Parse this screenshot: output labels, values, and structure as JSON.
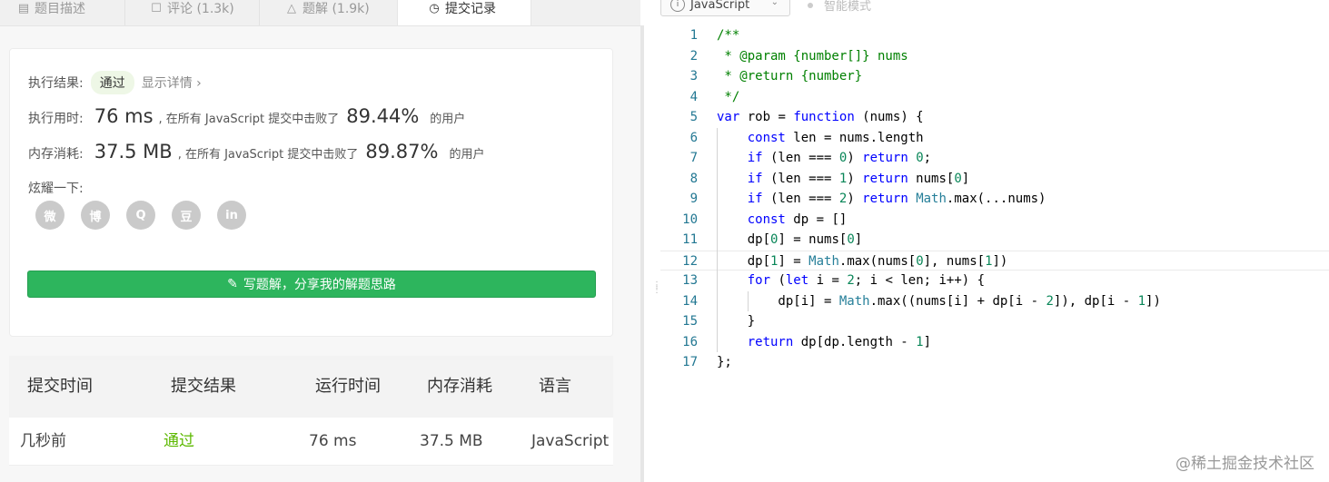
{
  "tabs": [
    {
      "label": "题目描述",
      "icon": "description-icon",
      "active": false
    },
    {
      "label": "评论 (1.3k)",
      "icon": "comment-icon",
      "active": false
    },
    {
      "label": "题解 (1.9k)",
      "icon": "solution-icon",
      "active": false
    },
    {
      "label": "提交记录",
      "icon": "clock-icon",
      "active": true
    }
  ],
  "result": {
    "status_label": "执行结果:",
    "status_value": "通过",
    "detail_link": "显示详情 ›",
    "runtime_label": "执行用时:",
    "runtime_value": "76 ms",
    "runtime_text": ", 在所有 JavaScript 提交中击败了",
    "runtime_percent": "89.44%",
    "runtime_suffix": "的用户",
    "memory_label": "内存消耗:",
    "memory_value": "37.5 MB",
    "memory_text": ", 在所有 JavaScript 提交中击败了",
    "memory_percent": "89.87%",
    "memory_suffix": "的用户",
    "share_label": "炫耀一下:",
    "share_icons": [
      "wechat-icon",
      "weibo-icon",
      "qq-icon",
      "douban-icon",
      "linkedin-icon"
    ],
    "share_glyphs": [
      "微",
      "博",
      "Q",
      "豆",
      "in"
    ],
    "solve_button": "写题解，分享我的解题思路"
  },
  "submissions": {
    "headers": [
      "提交时间",
      "提交结果",
      "运行时间",
      "内存消耗",
      "语言"
    ],
    "rows": [
      {
        "time": "几秒前",
        "result": "通过",
        "runtime": "76 ms",
        "memory": "37.5 MB",
        "language": "JavaScript"
      }
    ]
  },
  "editor": {
    "language": "JavaScript",
    "mode": "智能模式",
    "highlighted_line": 12,
    "lines": [
      "/**",
      " * @param {number[]} nums",
      " * @return {number}",
      " */",
      "var rob = function (nums) {",
      "    const len = nums.length",
      "    if (len === 0) return 0;",
      "    if (len === 1) return nums[0]",
      "    if (len === 2) return Math.max(...nums)",
      "    const dp = []",
      "    dp[0] = nums[0]",
      "    dp[1] = Math.max(nums[0], nums[1])",
      "    for (let i = 2; i < len; i++) {",
      "        dp[i] = Math.max((nums[i] + dp[i - 2]), dp[i - 1])",
      "    }",
      "    return dp[dp.length - 1]",
      "};"
    ]
  },
  "watermark": "@稀土掘金技术社区",
  "colors": {
    "accent_green": "#2db55d",
    "pass_green": "#5cb800",
    "keyword_blue": "#0000ff",
    "comment_green": "#008000"
  }
}
